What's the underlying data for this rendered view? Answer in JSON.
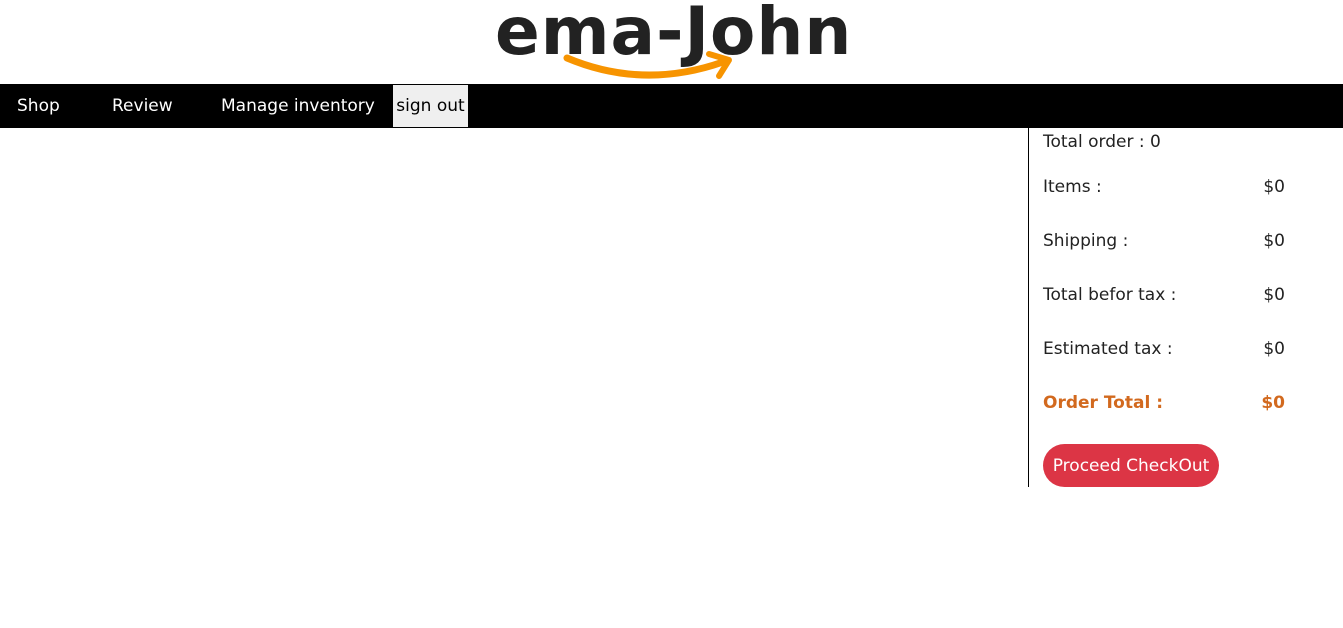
{
  "brand": {
    "logo_text": "ema-John",
    "accent_color": "#f79400"
  },
  "nav": {
    "items": [
      "Shop",
      "Review",
      "Manage inventory"
    ],
    "signout_label": "sign out"
  },
  "cart": {
    "total_order_label": "Total order : 0",
    "rows": [
      {
        "label": "Items :",
        "value": "$0"
      },
      {
        "label": "Shipping :",
        "value": "$0"
      },
      {
        "label": "Total befor tax :",
        "value": "$0"
      },
      {
        "label": "Estimated tax :",
        "value": "$0"
      }
    ],
    "order_total_label": "Order Total :",
    "order_total_value": "$0",
    "checkout_label": "Proceed CheckOut",
    "checkout_color": "#dc3545",
    "total_color": "#d2691e"
  }
}
